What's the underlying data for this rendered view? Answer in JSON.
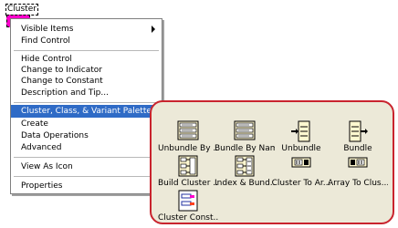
{
  "cluster": {
    "label": "Cluster"
  },
  "menu": {
    "items": [
      {
        "label": "Visible Items",
        "submenu": true
      },
      {
        "label": "Find Control",
        "submenu": false
      },
      {
        "label": "Hide Control",
        "submenu": false
      },
      {
        "label": "Change to Indicator",
        "submenu": false
      },
      {
        "label": "Change to Constant",
        "submenu": false
      },
      {
        "label": "Description and Tip...",
        "submenu": false
      },
      {
        "label": "Cluster, Class, & Variant Palette",
        "submenu": true,
        "selected": true
      },
      {
        "label": "Create",
        "submenu": true
      },
      {
        "label": "Data Operations",
        "submenu": true
      },
      {
        "label": "Advanced",
        "submenu": true
      },
      {
        "label": "View As Icon",
        "submenu": false
      },
      {
        "label": "Properties",
        "submenu": false
      }
    ]
  },
  "palette": {
    "tools": [
      {
        "label": "Unbundle By ...",
        "icon": "unbundle-by-name-icon"
      },
      {
        "label": "Bundle By Name",
        "icon": "bundle-by-name-icon"
      },
      {
        "label": "Unbundle",
        "icon": "unbundle-icon"
      },
      {
        "label": "Bundle",
        "icon": "bundle-icon"
      },
      {
        "label": "Build Cluster ...",
        "icon": "build-cluster-array-icon"
      },
      {
        "label": "Index & Bund...",
        "icon": "index-bundle-cluster-array-icon"
      },
      {
        "label": "Cluster To Ar...",
        "icon": "cluster-to-array-icon"
      },
      {
        "label": "Array To Clus...",
        "icon": "array-to-cluster-icon"
      },
      {
        "label": "Cluster Const...",
        "icon": "cluster-constant-icon"
      }
    ]
  },
  "colors": {
    "selection": "#2f6bc6",
    "palette_bg": "#ece9d8",
    "palette_border": "#c9242e",
    "cluster_wire": "#ff00cc"
  }
}
